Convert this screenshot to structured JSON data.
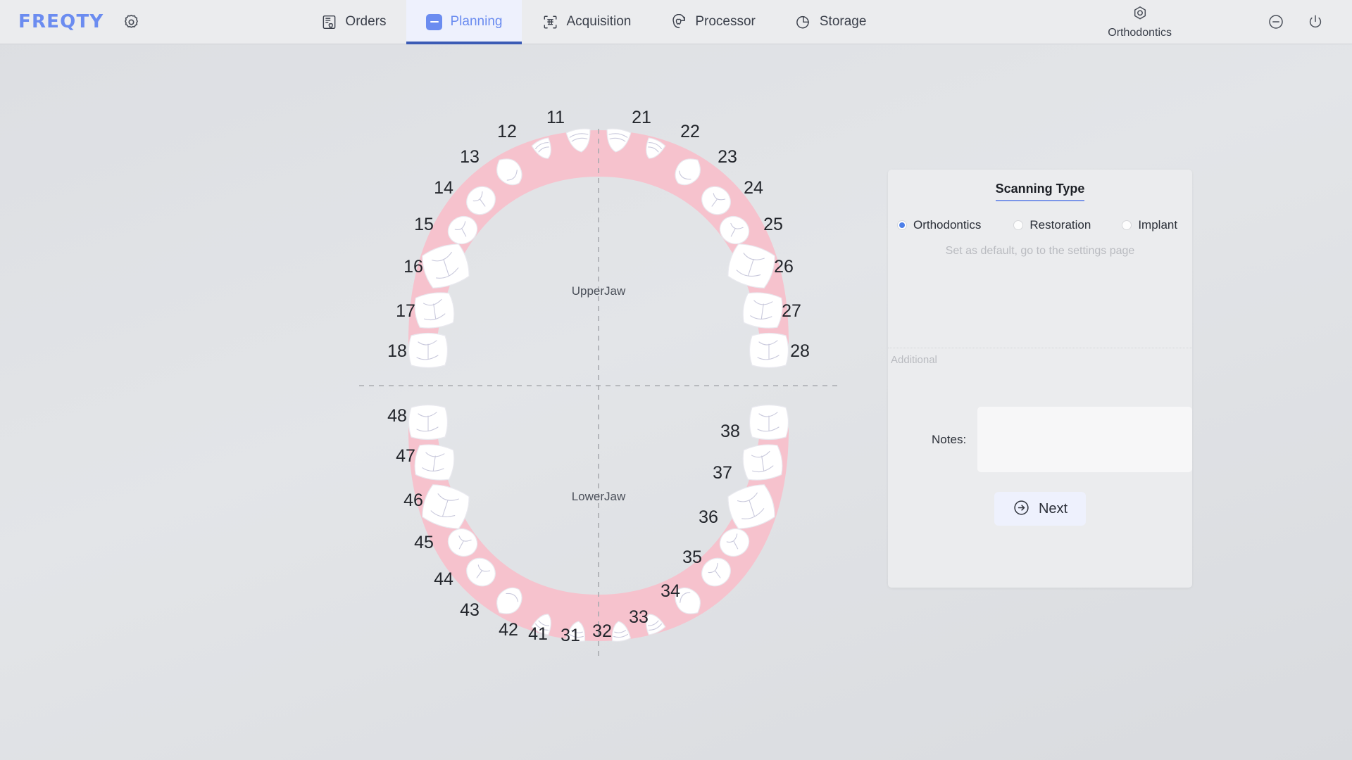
{
  "header": {
    "logo": "FREQTY",
    "settings_icon": "gear-icon",
    "tabs": [
      {
        "label": "Orders",
        "icon": "orders-document-tooth-icon",
        "active": false
      },
      {
        "label": "Planning",
        "icon": "planning-minus-chip-icon",
        "active": true
      },
      {
        "label": "Acquisition",
        "icon": "acquisition-scan-frame-icon",
        "active": false
      },
      {
        "label": "Processor",
        "icon": "processor-tooth-refresh-icon",
        "active": false
      },
      {
        "label": "Storage",
        "icon": "storage-pie-chart-icon",
        "active": false
      }
    ],
    "mode_badge": {
      "label": "Orthodontics",
      "icon": "hexagon-target-icon"
    },
    "minimize_label": "minimize-icon",
    "power_label": "power-icon"
  },
  "chart": {
    "upper_label": "UpperJaw",
    "lower_label": "LowerJaw",
    "upper_left": [
      "18",
      "17",
      "16",
      "15",
      "14",
      "13",
      "12",
      "11"
    ],
    "upper_right": [
      "21",
      "22",
      "23",
      "24",
      "25",
      "26",
      "27",
      "28"
    ],
    "lower_left": [
      "48",
      "47",
      "46",
      "45",
      "44",
      "43",
      "42",
      "41"
    ],
    "lower_right": [
      "31",
      "32",
      "33",
      "34",
      "35",
      "36",
      "37",
      "38"
    ],
    "gum_color": "#f6c2cd",
    "tooth_color": "#ffffff"
  },
  "panel": {
    "title": "Scanning Type",
    "options": [
      {
        "label": "Orthodontics",
        "selected": true
      },
      {
        "label": "Restoration",
        "selected": false
      },
      {
        "label": "Implant",
        "selected": false
      }
    ],
    "hint": "Set as default, go to the settings page",
    "section_label": "Additional",
    "notes_label": "Notes:",
    "notes_value": "",
    "notes_placeholder": "",
    "next_label": "Next",
    "next_icon": "arrow-right-circle-icon"
  },
  "colors": {
    "accent": "#6b8cf0",
    "accent_dark": "#3b5bb5",
    "radio_blue": "#4d7fe8",
    "gum_pink": "#f6c2cd"
  }
}
